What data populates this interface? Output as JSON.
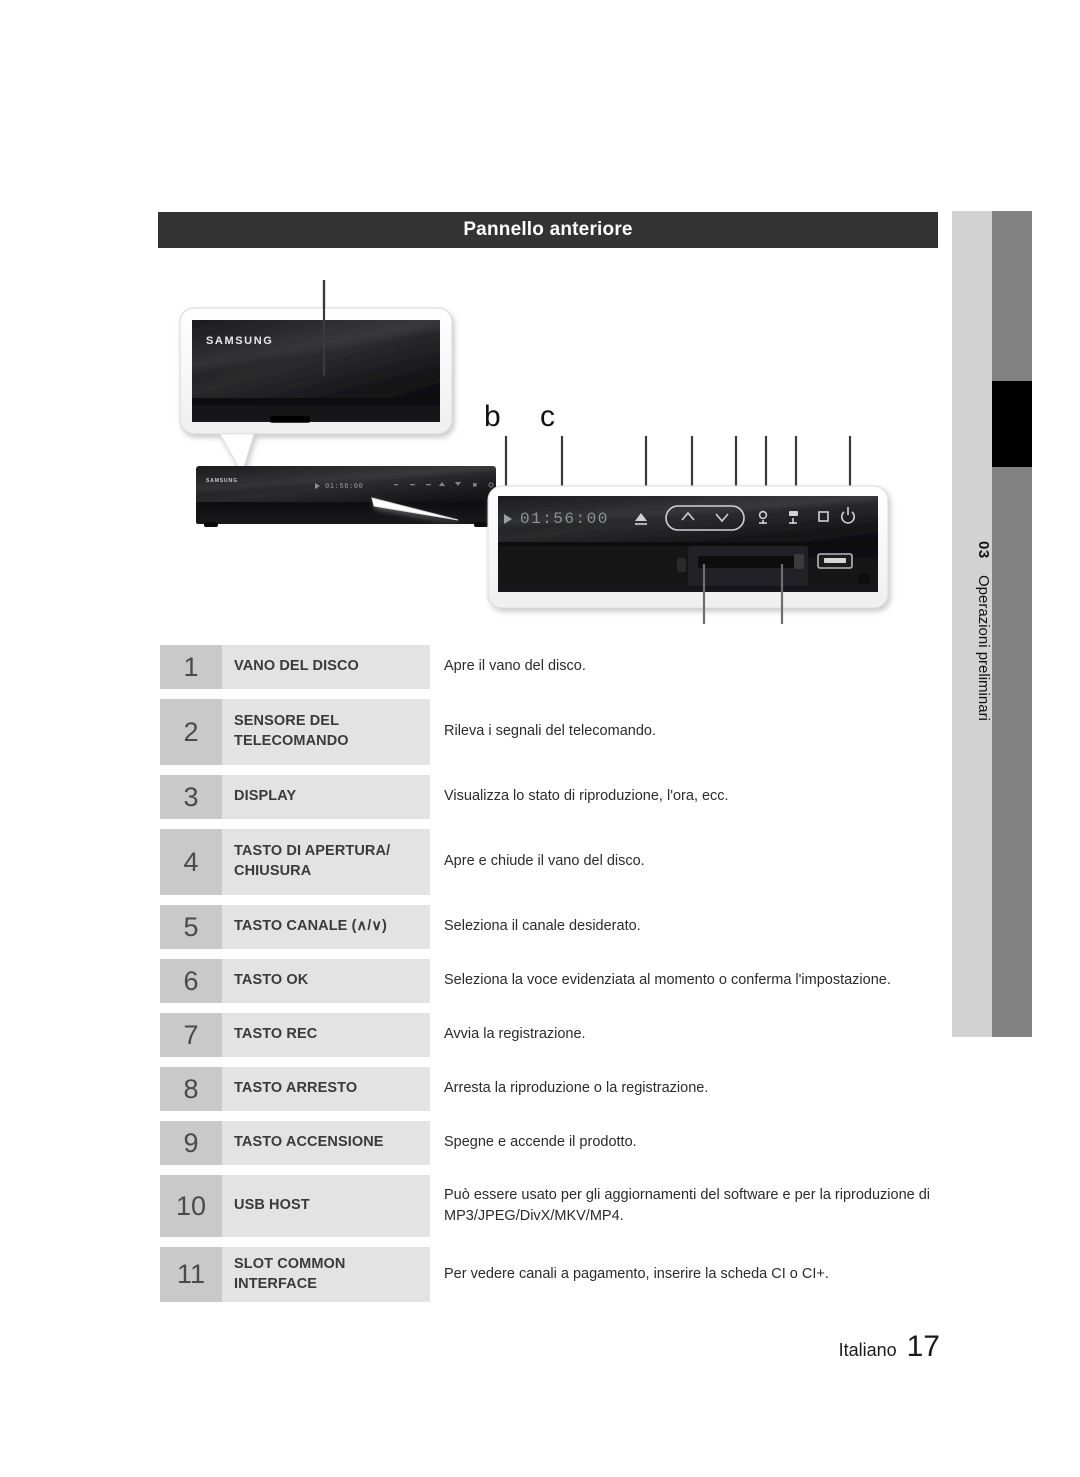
{
  "header": {
    "title": "Pannello anteriore"
  },
  "side_tab": {
    "chapter_number": "03",
    "chapter_label": "Operazioni preliminari",
    "light_color": "#d2d2d2",
    "dark_color": "#828282",
    "marker_color": "#000000"
  },
  "illustration": {
    "brand": "SAMSUNG",
    "display_time": "01:56:00",
    "callout_b": "b",
    "callout_c": "c",
    "buttons": [
      {
        "name": "eject-button",
        "glyph": "eject"
      },
      {
        "name": "channel-up-button",
        "glyph": "chevron-up"
      },
      {
        "name": "channel-down-button",
        "glyph": "chevron-down"
      },
      {
        "name": "ok-button",
        "glyph": "ok"
      },
      {
        "name": "rec-button",
        "glyph": "rec"
      },
      {
        "name": "stop-button",
        "glyph": "square"
      },
      {
        "name": "power-button",
        "glyph": "power"
      }
    ]
  },
  "legend": {
    "rows": [
      {
        "num": "1",
        "name": "VANO DEL DISCO",
        "desc": "Apre il vano del disco."
      },
      {
        "num": "2",
        "name": "SENSORE DEL TELECOMANDO",
        "desc": "Rileva i segnali del telecomando."
      },
      {
        "num": "3",
        "name": "DISPLAY",
        "desc": "Visualizza lo stato di riproduzione, l'ora, ecc."
      },
      {
        "num": "4",
        "name": "TASTO DI APERTURA/ CHIUSURA",
        "desc": "Apre e chiude il vano del disco."
      },
      {
        "num": "5",
        "name": "TASTO CANALE (∧/∨)",
        "desc": "Seleziona il canale desiderato."
      },
      {
        "num": "6",
        "name": "TASTO OK",
        "desc": "Seleziona la voce evidenziata al momento o conferma l'impostazione."
      },
      {
        "num": "7",
        "name": "TASTO REC",
        "desc": "Avvia la registrazione."
      },
      {
        "num": "8",
        "name": "TASTO ARRESTO",
        "desc": "Arresta la riproduzione o la registrazione."
      },
      {
        "num": "9",
        "name": "TASTO ACCENSIONE",
        "desc": "Spegne e accende il prodotto."
      },
      {
        "num": "10",
        "name": "USB HOST",
        "desc": "Può essere usato per gli aggiornamenti del software e per la riproduzione di MP3/JPEG/DivX/MKV/MP4."
      },
      {
        "num": "11",
        "name": "SLOT COMMON INTERFACE",
        "desc": "Per vedere canali a pagamento, inserire la scheda CI o CI+."
      }
    ]
  },
  "footer": {
    "language": "Italiano",
    "page_number": "17"
  }
}
